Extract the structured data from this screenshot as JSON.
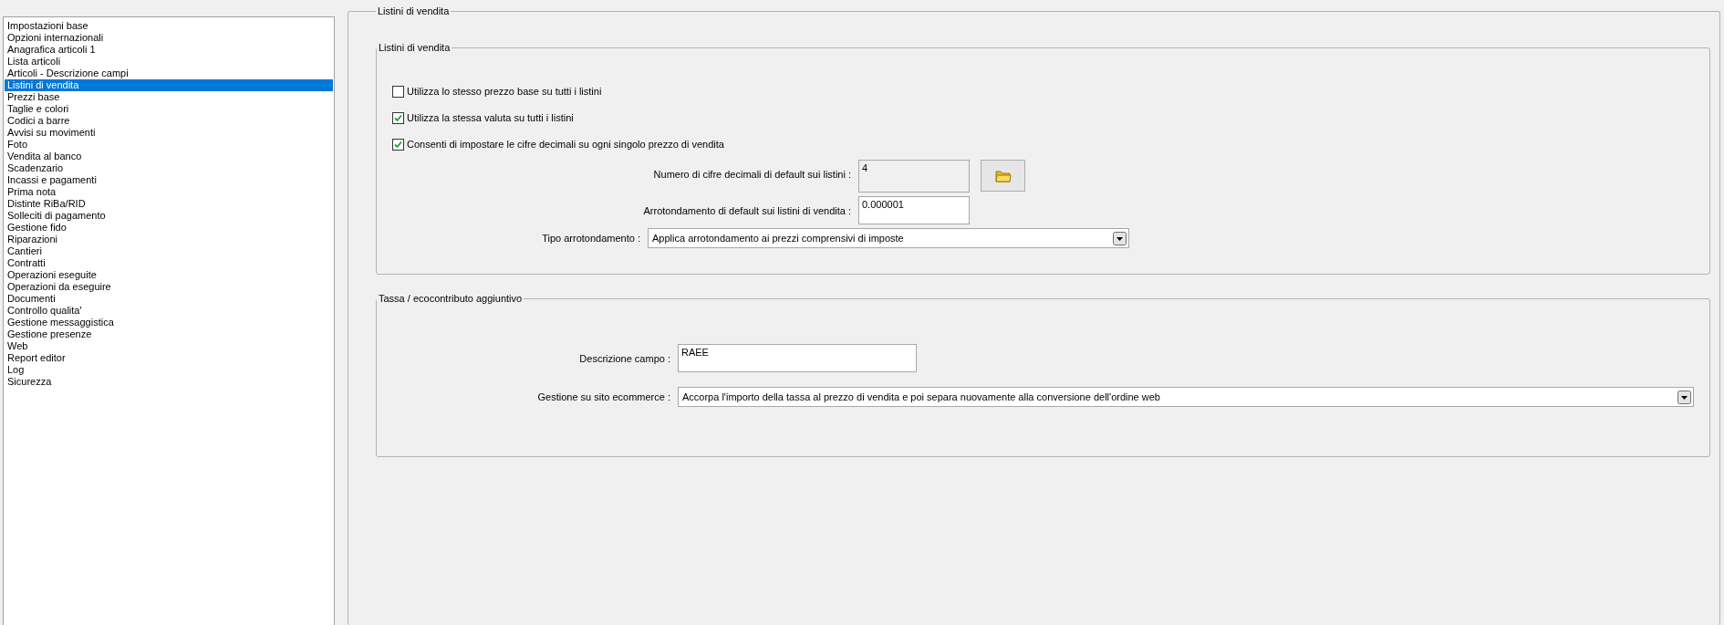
{
  "sidebar": {
    "items": [
      {
        "label": "Impostazioni base",
        "selected": false
      },
      {
        "label": "Opzioni internazionali",
        "selected": false
      },
      {
        "label": "Anagrafica articoli 1",
        "selected": false
      },
      {
        "label": "Lista articoli",
        "selected": false
      },
      {
        "label": "Articoli - Descrizione campi",
        "selected": false
      },
      {
        "label": "Listini di vendita",
        "selected": true
      },
      {
        "label": "Prezzi base",
        "selected": false
      },
      {
        "label": "Taglie e colori",
        "selected": false
      },
      {
        "label": "Codici a barre",
        "selected": false
      },
      {
        "label": "Avvisi su movimenti",
        "selected": false
      },
      {
        "label": "Foto",
        "selected": false
      },
      {
        "label": "Vendita al banco",
        "selected": false
      },
      {
        "label": "Scadenzario",
        "selected": false
      },
      {
        "label": "Incassi e pagamenti",
        "selected": false
      },
      {
        "label": "Prima nota",
        "selected": false
      },
      {
        "label": "Distinte RiBa/RID",
        "selected": false
      },
      {
        "label": "Solleciti di pagamento",
        "selected": false
      },
      {
        "label": "Gestione fido",
        "selected": false
      },
      {
        "label": "Riparazioni",
        "selected": false
      },
      {
        "label": "Cantieri",
        "selected": false
      },
      {
        "label": "Contratti",
        "selected": false
      },
      {
        "label": "Operazioni eseguite",
        "selected": false
      },
      {
        "label": "Operazioni da eseguire",
        "selected": false
      },
      {
        "label": "Documenti",
        "selected": false
      },
      {
        "label": "Controllo qualita'",
        "selected": false
      },
      {
        "label": "Gestione messaggistica",
        "selected": false
      },
      {
        "label": "Gestione presenze",
        "selected": false
      },
      {
        "label": "Web",
        "selected": false
      },
      {
        "label": "Report editor",
        "selected": false
      },
      {
        "label": "Log",
        "selected": false
      },
      {
        "label": "Sicurezza",
        "selected": false
      }
    ]
  },
  "panel": {
    "title": "Listini di vendita",
    "groups": [
      {
        "title": "Listini di vendita",
        "checkboxes": [
          {
            "label": "Utilizza lo stesso prezzo base su tutti i listini",
            "checked": false
          },
          {
            "label": "Utilizza la stessa valuta su tutti i listini",
            "checked": true
          },
          {
            "label": "Consenti di impostare le cifre decimali su ogni singolo prezzo di vendita",
            "checked": true
          }
        ],
        "fields": [
          {
            "kind": "readonly",
            "label": "Numero di cifre decimali di default sui listini :",
            "value": "4"
          },
          {
            "kind": "text",
            "label": "Arrotondamento di default sui listini di vendita :",
            "value": "0.000001"
          },
          {
            "kind": "select",
            "label": "Tipo arrotondamento :",
            "value": "Applica arrotondamento ai prezzi comprensivi di imposte"
          }
        ]
      },
      {
        "title": "Tassa / ecocontributo aggiuntivo",
        "fields": [
          {
            "kind": "text",
            "label": "Descrizione campo :",
            "value": "RAEE"
          },
          {
            "kind": "select",
            "label": "Gestione su sito ecommerce :",
            "value": "Accorpa l'importo della tassa al prezzo di vendita e poi separa nuovamente alla conversione dell'ordine web"
          }
        ]
      }
    ]
  }
}
